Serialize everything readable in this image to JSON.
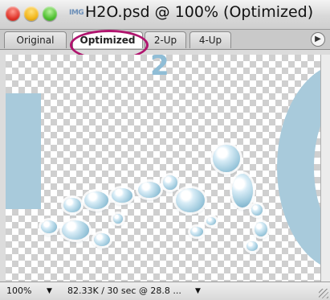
{
  "window": {
    "title": "H2O.psd @ 100% (Optimized)",
    "doc_icon": "IMG"
  },
  "tabs": [
    {
      "label": "Original"
    },
    {
      "label": "Optimized"
    },
    {
      "label": "2-Up"
    },
    {
      "label": "4-Up"
    }
  ],
  "status": {
    "zoom": "100%",
    "info": "82.33K / 30 sec @ 28.8 ..."
  },
  "icons": {
    "close": "close-button-icon",
    "minimize": "minimize-button-icon",
    "zoom": "zoom-button-icon",
    "tab_menu": "triangle-right-icon",
    "dropdown": "triangle-down-icon"
  },
  "colors": {
    "highlight": "#b0146e",
    "art_blue": "#a8cadb"
  }
}
